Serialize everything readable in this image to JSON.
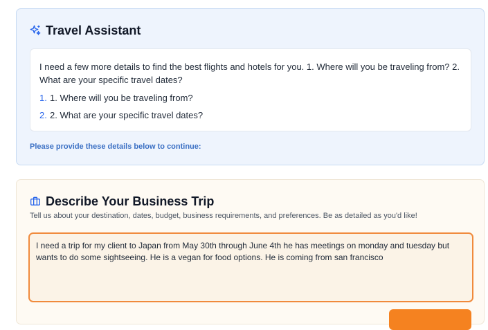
{
  "assistant": {
    "title": "Travel Assistant",
    "message": "I need a few more details to find the best flights and hotels for you. 1. Where will you be traveling from? 2. What are your specific travel dates?",
    "questions": [
      {
        "number": "1.",
        "text": "1. Where will you be traveling from?"
      },
      {
        "number": "2.",
        "text": "2. What are your specific travel dates?"
      }
    ],
    "prompt_note": "Please provide these details below to continue:",
    "icon": "sparkles-icon"
  },
  "trip_form": {
    "title": "Describe Your Business Trip",
    "subtitle": "Tell us about your destination, dates, budget, business requirements, and preferences. Be as detailed as you'd like!",
    "description_value": "I need a trip for my client to Japan from May 30th through June 4th he has meetings on monday and tuesday but wants to do some sightseeing. He is a vegan for food options. He is coming from san francisco",
    "icon": "briefcase-icon"
  },
  "colors": {
    "accent_blue": "#2563eb",
    "accent_orange": "#f58220",
    "focus_border": "#f08a3c"
  }
}
